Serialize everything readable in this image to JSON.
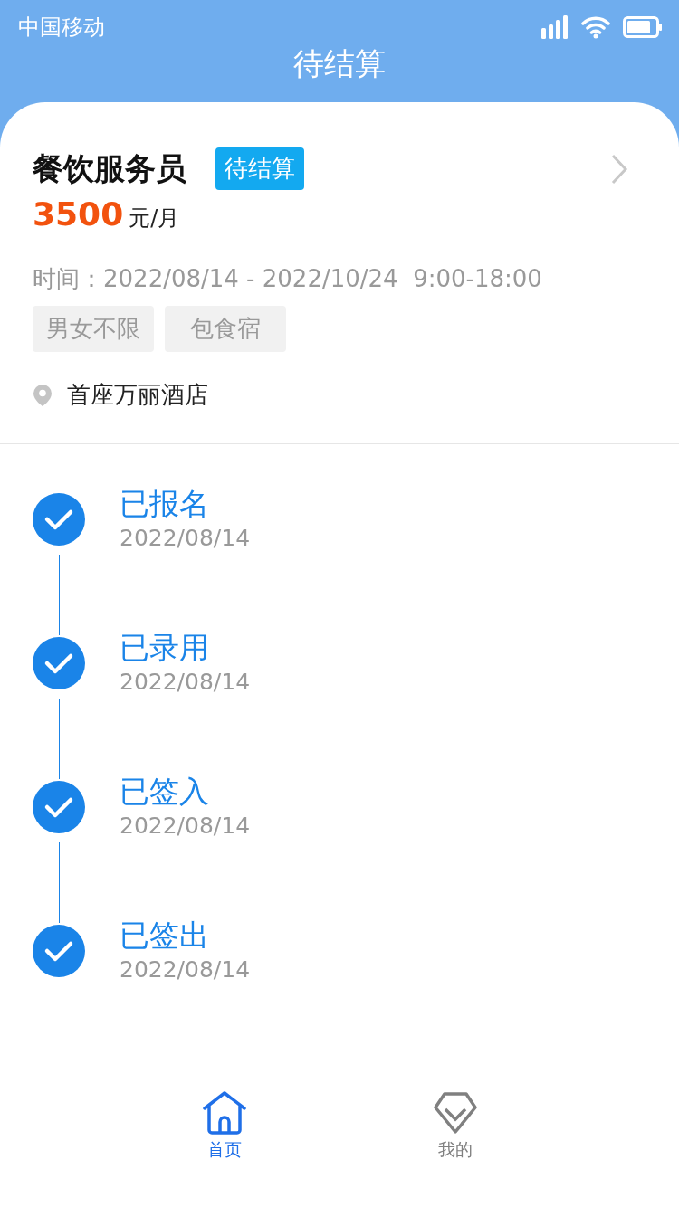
{
  "status_bar": {
    "carrier": "中国移动"
  },
  "header": {
    "title": "待结算"
  },
  "job": {
    "title": "餐饮服务员",
    "status": "待结算",
    "salary": "3500",
    "salary_unit": "元/月",
    "time": "时间：2022/08/14 - 2022/10/24  9:00-18:00",
    "tags": [
      "男女不限",
      "包食宿"
    ],
    "location": "首座万丽酒店"
  },
  "steps": [
    {
      "label": "已报名",
      "date": "2022/08/14",
      "done": true
    },
    {
      "label": "已录用",
      "date": "2022/08/14",
      "done": true
    },
    {
      "label": "已签入",
      "date": "2022/08/14",
      "done": true
    },
    {
      "label": "已签出",
      "date": "2022/08/14",
      "done": true
    }
  ],
  "tab_bar": [
    {
      "label": "首页",
      "kind": "home",
      "selected": true
    },
    {
      "label": "我的",
      "kind": "gem",
      "selected": false
    }
  ]
}
